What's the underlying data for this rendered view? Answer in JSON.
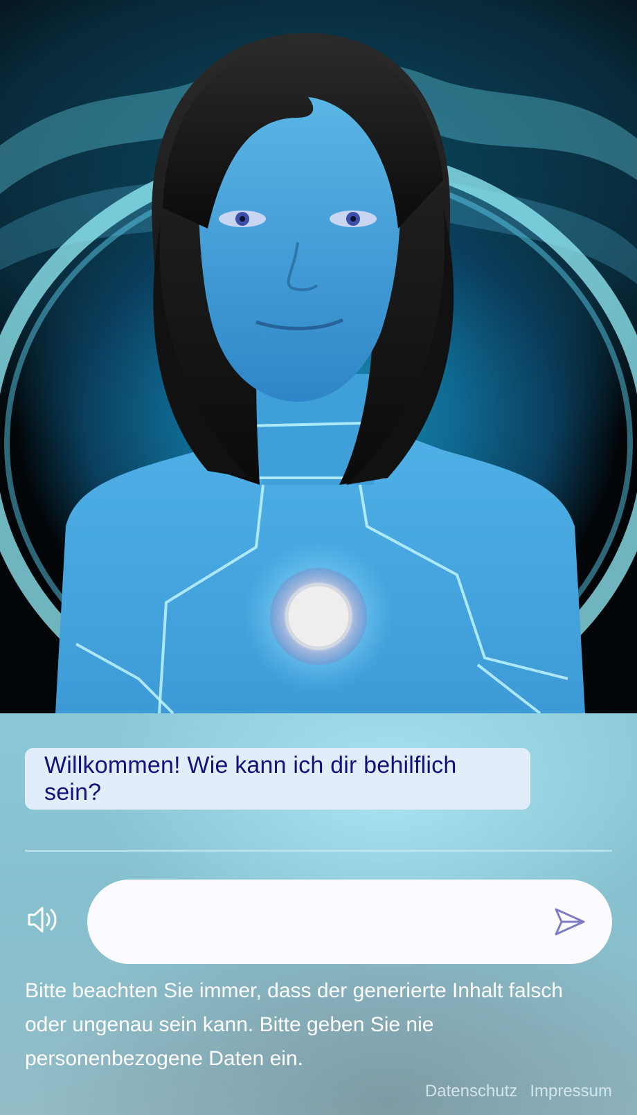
{
  "avatar": {
    "description_icon": "avatar-figure"
  },
  "chat": {
    "messages": [
      {
        "role": "assistant",
        "text": "Willkommen! Wie kann ich dir behilflich sein?"
      }
    ]
  },
  "composer": {
    "value": "",
    "placeholder": "",
    "speaker_icon": "speaker-icon",
    "send_icon": "send-icon"
  },
  "notice": {
    "text": "Bitte beachten Sie immer, dass der generierte Inhalt falsch oder ungenau sein kann. Bitte geben Sie nie personenbezogene Daten ein."
  },
  "footer": {
    "privacy_label": "Datenschutz",
    "imprint_label": "Impressum"
  },
  "colors": {
    "bubble_bg": "#e1eefa",
    "bubble_text": "#12127a",
    "send_icon": "#7d7cc4",
    "panel": "#8cc9d7"
  }
}
